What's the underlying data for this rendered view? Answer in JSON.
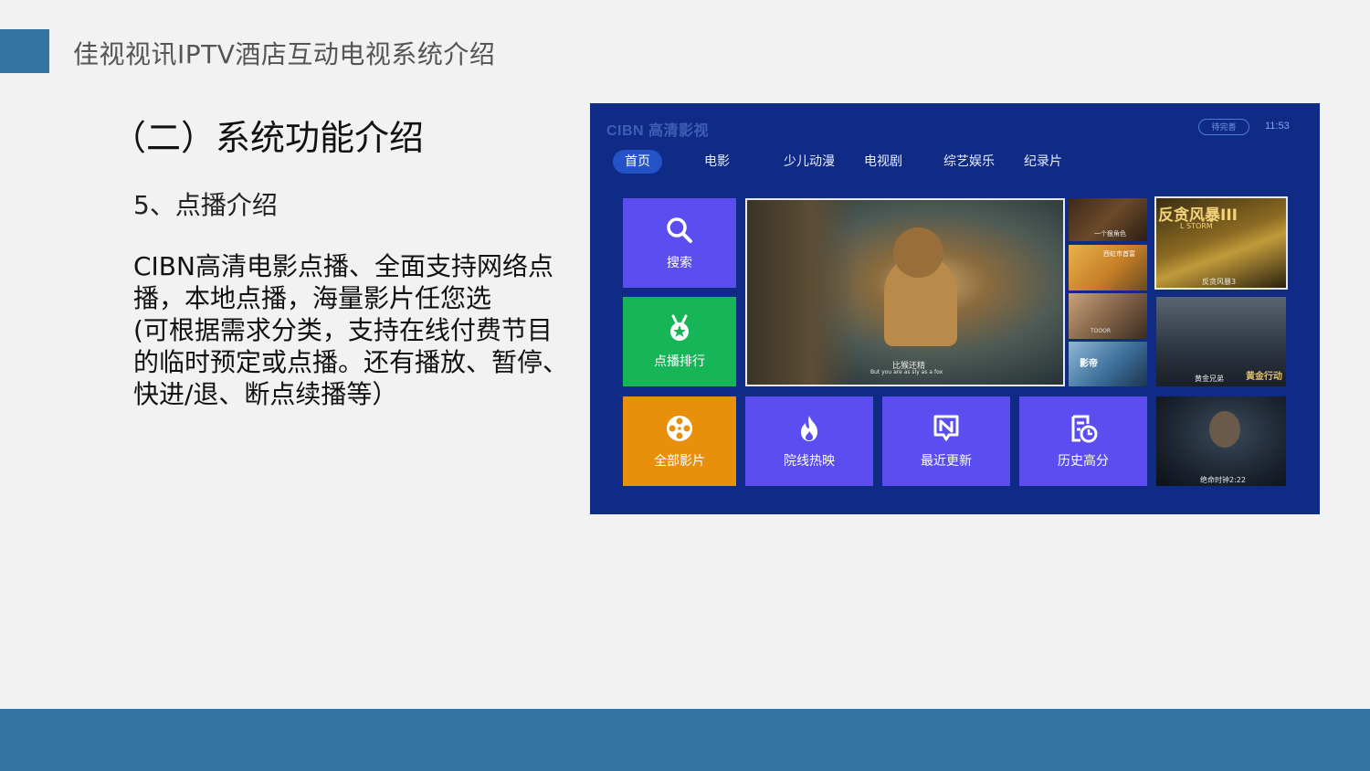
{
  "header": {
    "title": "佳视视讯IPTV酒店互动电视系统介绍"
  },
  "section_title": "（二）系统功能介绍",
  "sub_title": "5、点播介绍",
  "description_lines": [
    "CIBN高清电影点播、全面支持网络点",
    "播，本地点播，海量影片任您选",
    "(可根据需求分类，支持在线付费节目",
    "的临时预定或点播。还有播放、暂停、",
    "快进/退、断点续播等）"
  ],
  "tv": {
    "logo": "CIBN 高清影视",
    "user_badge": "待完善",
    "time": "11:53",
    "tabs": [
      "首页",
      "电影",
      "少儿动漫",
      "电视剧",
      "综艺娱乐",
      "纪录片"
    ],
    "active_tab": "首页",
    "tiles": {
      "search": "搜索",
      "ranking": "点播排行",
      "all_movies": "全部影片",
      "in_theaters": "院线热映",
      "recent": "最近更新",
      "top_rated": "历史高分"
    },
    "featured_subtitle": "比猴还精",
    "featured_subtitle_en": "But you are as sly as a fox",
    "poster_captions": {
      "poster_1": "一个狠角色",
      "poster_2": "西虹市首富",
      "poster_3": "TOOOR",
      "poster_4": "影帝",
      "poster_storm": "反贪风暴3",
      "poster_storm_title": "反贪风暴III",
      "poster_storm_sub": "L STORM",
      "poster_brothers": "黄金兄弟",
      "poster_brothers_sub": "黄金行动",
      "poster_last": "绝命时钟2:22"
    }
  },
  "colors": {
    "accent": "#3573a1",
    "tv_bg": "#102b86",
    "tile_purple": "#5b4df0",
    "tile_green": "#15b558",
    "tile_orange": "#e8900c"
  }
}
